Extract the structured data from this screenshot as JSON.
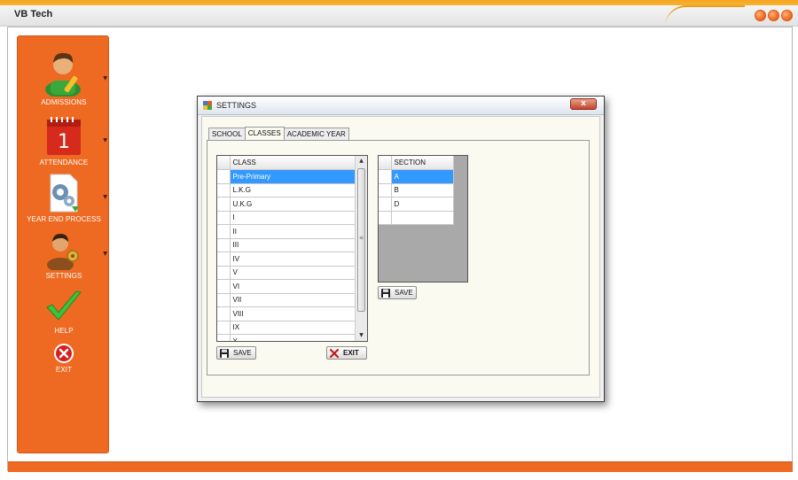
{
  "app": {
    "title": "VB Tech"
  },
  "sidebar": {
    "items": [
      {
        "label": "ADMISSIONS",
        "icon": "student-icon"
      },
      {
        "label": "ATTENDANCE",
        "icon": "calendar-icon"
      },
      {
        "label": "YEAR END PROCESS",
        "icon": "gear-document-icon"
      },
      {
        "label": "SETTINGS",
        "icon": "user-settings-icon"
      },
      {
        "label": "HELP",
        "icon": "checkmark-icon"
      },
      {
        "label": "EXIT",
        "icon": "exit-icon"
      }
    ],
    "calendar_day": "1"
  },
  "dialog": {
    "title": "SETTINGS",
    "close_label": "x",
    "tabs": [
      {
        "label": "SCHOOL",
        "active": false
      },
      {
        "label": "CLASSES",
        "active": true
      },
      {
        "label": "ACADEMIC YEAR",
        "active": false
      }
    ],
    "class_grid": {
      "header": "CLASS",
      "rows": [
        "Pre-Primary",
        "L.K.G",
        "U.K.G",
        "I",
        "II",
        "III",
        "IV",
        "V",
        "VI",
        "VII",
        "VIII",
        "IX",
        "X"
      ],
      "selected_index": 0
    },
    "section_grid": {
      "header": "SECTION",
      "rows": [
        "A",
        "B",
        "D",
        ""
      ],
      "selected_index": 0
    },
    "buttons": {
      "class_save": "SAVE",
      "exit": "EXIT",
      "section_save": "SAVE"
    }
  },
  "colors": {
    "accent": "#ee6a22",
    "selection": "#3399ff",
    "title_strip": "#f6a51b"
  }
}
